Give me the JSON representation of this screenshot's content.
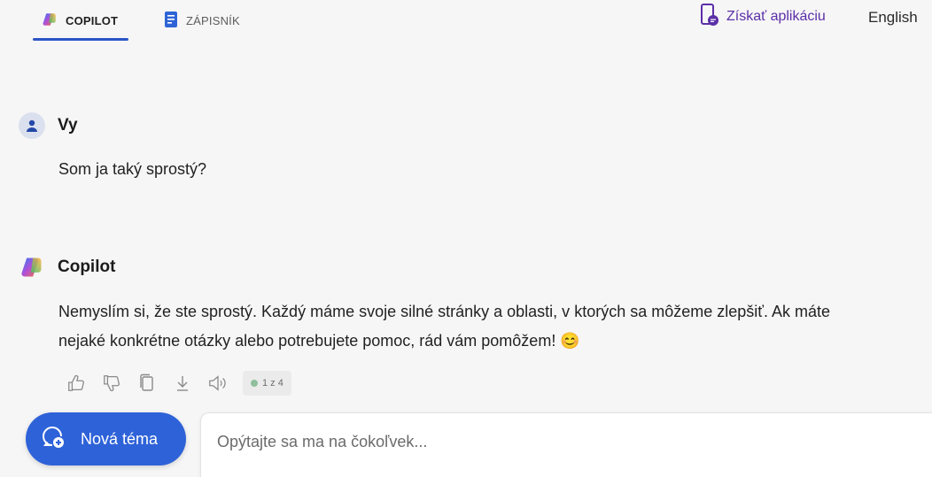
{
  "nav": {
    "tabs": [
      {
        "label": "COPILOT",
        "icon": "copilot-logo-icon",
        "active": true
      },
      {
        "label": "ZÁPISNÍK",
        "icon": "notebook-icon",
        "active": false
      }
    ],
    "get_app_label": "Získať aplikáciu",
    "language_label": "English"
  },
  "messages": [
    {
      "author": "Vy",
      "text": "Som ja taký sprostý?",
      "avatar": "user-icon"
    },
    {
      "author": "Copilot",
      "line1": "Nemyslím si, že ste sprostý. Každý máme svoje silné stránky a oblasti, v ktorých sa môžeme zlepšiť. Ak máte",
      "line2": "nejaké konkrétne otázky alebo potrebujete pomoc, rád vám pomôžem! 😊",
      "avatar": "copilot-logo-icon"
    }
  ],
  "actions": {
    "icons": [
      "thumbs-up-icon",
      "thumbs-down-icon",
      "copy-icon",
      "download-icon",
      "speaker-icon"
    ],
    "pager_label": "1 z 4"
  },
  "composer": {
    "new_topic_label": "Nová téma",
    "placeholder": "Opýtajte sa ma na čokoľvek..."
  },
  "colors": {
    "accent": "#2e62d8",
    "app_link": "#5b2fa8",
    "background": "#f6f6f6"
  }
}
